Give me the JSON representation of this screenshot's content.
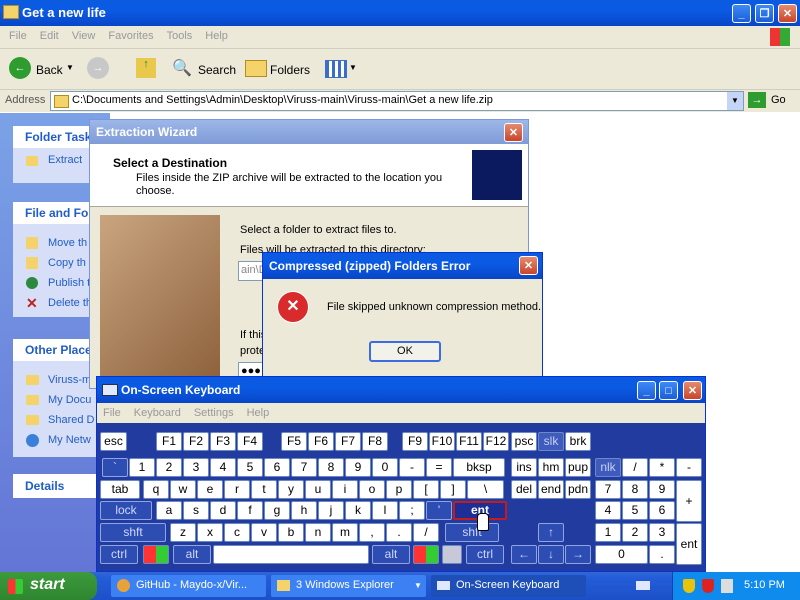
{
  "explorer": {
    "title": "Get a new life",
    "menu": [
      "File",
      "Edit",
      "View",
      "Favorites",
      "Tools",
      "Help"
    ],
    "back_label": "Back",
    "search_label": "Search",
    "folders_label": "Folders",
    "address_label": "Address",
    "address_value": "C:\\Documents and Settings\\Admin\\Desktop\\Viruss-main\\Viruss-main\\Get a new life.zip",
    "go_label": "Go",
    "panel_folder_tasks": {
      "title": "Folder Task",
      "items": [
        "Extract"
      ]
    },
    "panel_file": {
      "title": "File and Fol",
      "items": [
        "Move th",
        "Copy th",
        "Publish t",
        "Delete th"
      ]
    },
    "panel_other": {
      "title": "Other Place",
      "items": [
        "Viruss-m",
        "My Docu",
        "Shared D",
        "My Netw"
      ]
    },
    "panel_details": {
      "title": "Details"
    }
  },
  "wizard": {
    "title": "Extraction Wizard",
    "heading": "Select a Destination",
    "subheading_line1": "Files inside the ZIP archive will be extracted to the location you",
    "subheading_line2": "choose.",
    "select_folder_label": "Select a folder to extract files to.",
    "will_extract_label": "Files will be extracted to this directory:",
    "path_fragment": "ain\\D",
    "if_this": "If this",
    "prote": "prote",
    "password_dots": "●●●"
  },
  "error_dialog": {
    "title": "Compressed (zipped) Folders Error",
    "message": "File skipped unknown compression method.",
    "ok_label": "OK"
  },
  "osk": {
    "title": "On-Screen Keyboard",
    "menu": [
      "File",
      "Keyboard",
      "Settings",
      "Help"
    ],
    "row_fn": [
      "esc",
      "F1",
      "F2",
      "F3",
      "F4",
      "F5",
      "F6",
      "F7",
      "F8",
      "F9",
      "F10",
      "F11",
      "F12",
      "psc",
      "slk",
      "brk"
    ],
    "row_num": [
      "`",
      "1",
      "2",
      "3",
      "4",
      "5",
      "6",
      "7",
      "8",
      "9",
      "0",
      "-",
      "=",
      "bksp"
    ],
    "row_tab": [
      "tab",
      "q",
      "w",
      "e",
      "r",
      "t",
      "y",
      "u",
      "i",
      "o",
      "p",
      "[",
      "]",
      "\\"
    ],
    "row_caps": [
      "lock",
      "a",
      "s",
      "d",
      "f",
      "g",
      "h",
      "j",
      "k",
      "l",
      ";",
      "'",
      "ent"
    ],
    "row_shift": [
      "shft",
      "z",
      "x",
      "c",
      "v",
      "b",
      "n",
      "m",
      ",",
      ".",
      "/",
      "shft"
    ],
    "row_ctrl": [
      "ctrl",
      "alt",
      "alt",
      "ctrl"
    ],
    "nav_top": [
      "ins",
      "hm",
      "pup"
    ],
    "nav_bot": [
      "del",
      "end",
      "pdn"
    ],
    "numpad": [
      "nlk",
      "/",
      "*",
      "-",
      "7",
      "8",
      "9",
      "+",
      "4",
      "5",
      "6",
      "1",
      "2",
      "3",
      "ent",
      "0",
      "."
    ]
  },
  "taskbar": {
    "start_label": "start",
    "items": [
      "GitHub - Maydo-x/Vir...",
      "3 Windows Explorer",
      "On-Screen Keyboard"
    ],
    "clock": "5:10 PM"
  }
}
